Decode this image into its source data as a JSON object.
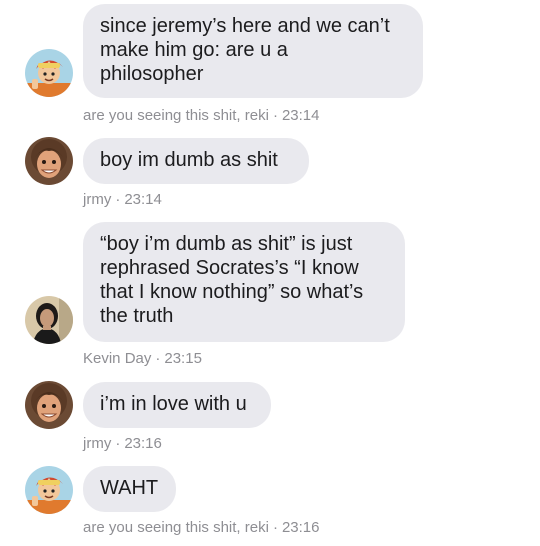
{
  "messages": [
    {
      "text": "since jeremy’s here and we can’t\nmake him go: are u a\nphilosopher",
      "sender": "are you seeing this shit, reki",
      "time": "23:14",
      "avatar": "cartoon-boy-avatar"
    },
    {
      "text": "boy im dumb as shit",
      "sender": "jrmy",
      "time": "23:14",
      "avatar": "smiling-boy-avatar"
    },
    {
      "text": "“boy i’m dumb as shit” is just\nrephrased Socrates’s “I know\nthat I know nothing” so what’s\nthe truth",
      "sender": "Kevin Day",
      "time": "23:15",
      "avatar": "dark-haired-person-avatar"
    },
    {
      "text": "i’m in love with u",
      "sender": "jrmy",
      "time": "23:16",
      "avatar": "smiling-boy-avatar"
    },
    {
      "text": "WAHT",
      "sender": "are you seeing this shit, reki",
      "time": "23:16",
      "avatar": "cartoon-boy-avatar"
    }
  ],
  "colors": {
    "bubble": "#e9e9ee",
    "meta_text": "#8e8e93",
    "text": "#1c1c1e"
  }
}
